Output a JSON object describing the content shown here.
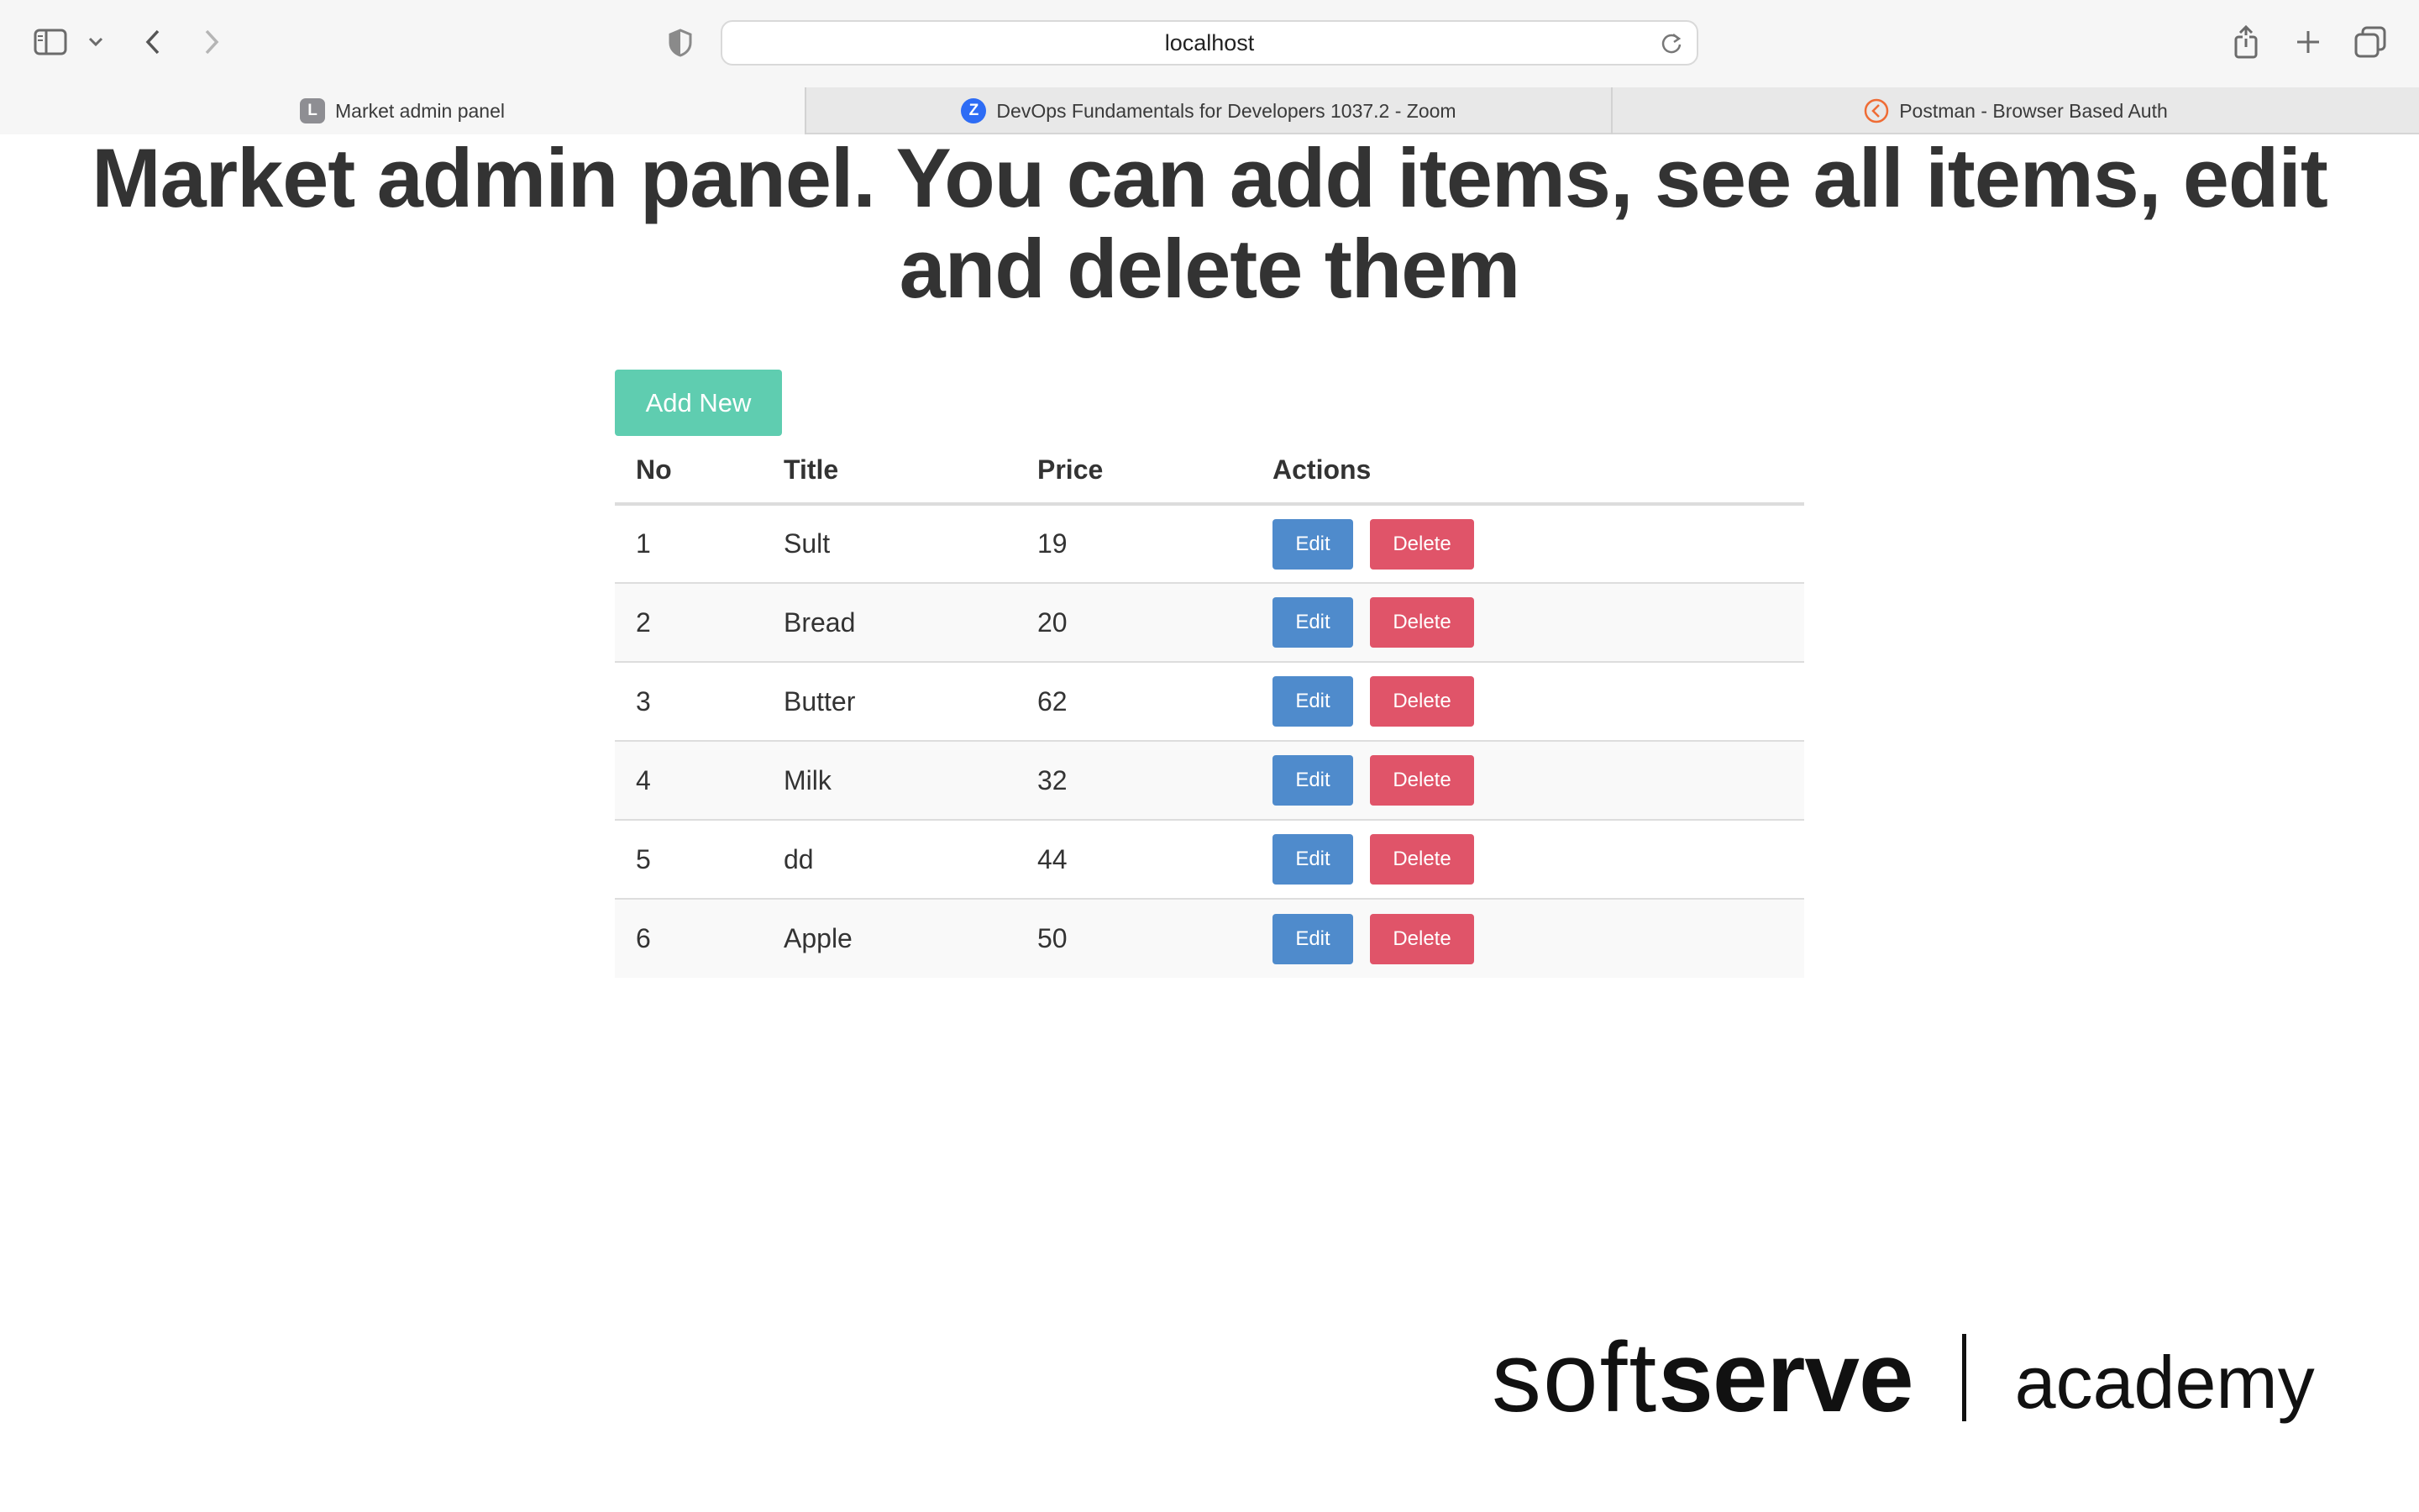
{
  "browser": {
    "url": "localhost",
    "tabs": [
      {
        "label": "Market admin panel",
        "favicon_letter": "L",
        "favicon_color": "#8e8e93",
        "active": true
      },
      {
        "label": "DevOps Fundamentals for Developers 1037.2 - Zoom",
        "favicon_letter": "Z",
        "favicon_color": "#2d6cf5",
        "active": false
      },
      {
        "label": "Postman - Browser Based Auth",
        "favicon_letter": "",
        "favicon_color": "#ef6c35",
        "active": false
      }
    ]
  },
  "page": {
    "title": "Market admin panel. You can add items, see all items, edit and delete them",
    "add_button_label": "Add New",
    "table": {
      "headers": [
        "No",
        "Title",
        "Price",
        "Actions"
      ],
      "rows": [
        {
          "no": "1",
          "title": "Sult",
          "price": "19"
        },
        {
          "no": "2",
          "title": "Bread",
          "price": "20"
        },
        {
          "no": "3",
          "title": "Butter",
          "price": "62"
        },
        {
          "no": "4",
          "title": "Milk",
          "price": "32"
        },
        {
          "no": "5",
          "title": "dd",
          "price": "44"
        },
        {
          "no": "6",
          "title": "Apple",
          "price": "50"
        }
      ],
      "edit_label": "Edit",
      "delete_label": "Delete"
    }
  },
  "logo": {
    "part1": "soft",
    "part2": "serve",
    "part3": "academy"
  },
  "colors": {
    "add_button": "#5fcdb0",
    "edit_button": "#4f8bcc",
    "delete_button": "#e05469"
  }
}
